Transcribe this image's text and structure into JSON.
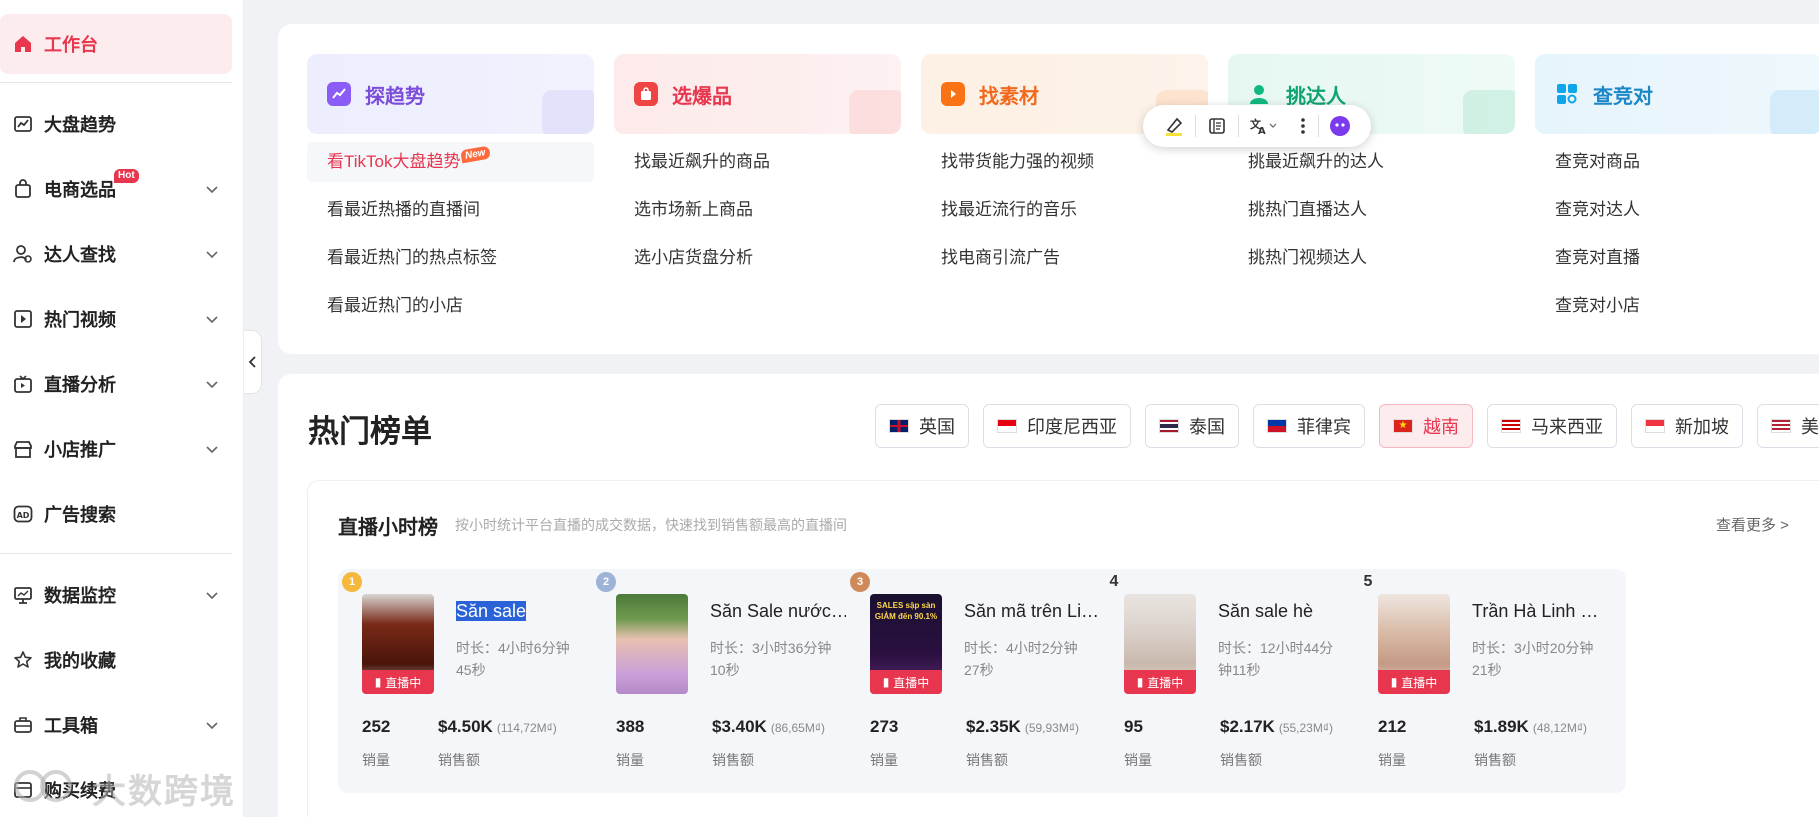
{
  "sidebar": {
    "items": [
      {
        "label": "工作台",
        "icon": "home-icon"
      },
      {
        "label": "大盘趋势",
        "icon": "trend-chart-icon"
      },
      {
        "label": "电商选品",
        "icon": "shopping-bag-icon",
        "badge": "Hot"
      },
      {
        "label": "达人查找",
        "icon": "user-search-icon"
      },
      {
        "label": "热门视频",
        "icon": "video-icon"
      },
      {
        "label": "直播分析",
        "icon": "tv-live-icon"
      },
      {
        "label": "小店推广",
        "icon": "shop-icon"
      },
      {
        "label": "广告搜索",
        "icon": "ad-icon"
      },
      {
        "label": "数据监控",
        "icon": "monitor-icon"
      },
      {
        "label": "我的收藏",
        "icon": "star-icon"
      },
      {
        "label": "工具箱",
        "icon": "toolbox-icon"
      },
      {
        "label": "购买续费",
        "icon": "cart-icon"
      }
    ],
    "watermark": "大数跨境"
  },
  "categories": [
    {
      "title": "探趋势",
      "links": [
        "看TikTok大盘趋势",
        "看最近热播的直播间",
        "看最近热门的热点标签",
        "看最近热门的小店"
      ],
      "new_badge": "New"
    },
    {
      "title": "选爆品",
      "links": [
        "找最近飙升的商品",
        "选市场新上商品",
        "选小店货盘分析"
      ]
    },
    {
      "title": "找素材",
      "links": [
        "找带货能力强的视频",
        "找最近流行的音乐",
        "找电商引流广告"
      ]
    },
    {
      "title": "挑达人",
      "links": [
        "挑最近飙升的达人",
        "挑热门直播达人",
        "挑热门视频达人"
      ]
    },
    {
      "title": "查竞对",
      "links": [
        "查竞对商品",
        "查竞对达人",
        "查竞对直播",
        "查竞对小店"
      ]
    }
  ],
  "hot_list": {
    "title": "热门榜单",
    "countries": [
      "英国",
      "印度尼西亚",
      "泰国",
      "菲律宾",
      "越南",
      "马来西亚",
      "新加坡",
      "美国"
    ],
    "active_country": "越南",
    "board": {
      "title": "直播小时榜",
      "subtitle": "按小时统计平台直播的成交数据，快速找到销售额最高的直播间",
      "more": "查看更多 >",
      "live_tag": "直播中",
      "duration_prefix": "时长：",
      "sales_label": "销量",
      "revenue_label": "销售额",
      "items": [
        {
          "rank": "1",
          "name": "Săn sale",
          "dur1": "4小时6分钟",
          "dur2": "45秒",
          "sales": "252",
          "revenue": "$4.50K",
          "local": "(114,72M₫)"
        },
        {
          "rank": "2",
          "name": "Săn Sale nước…",
          "dur1": "3小时36分钟",
          "dur2": "10秒",
          "sales": "388",
          "revenue": "$3.40K",
          "local": "(86,65M₫)"
        },
        {
          "rank": "3",
          "name": "Săn mã trên Li…",
          "dur1": "4小时2分钟",
          "dur2": "27秒",
          "sales": "273",
          "revenue": "$2.35K",
          "local": "(59,93M₫)",
          "thumb_text": "SALES sập sàn GIẢM đến 90.1%"
        },
        {
          "rank": "4",
          "name": "Săn sale hè",
          "dur1": "12小时44分",
          "dur2": "钟11秒",
          "sales": "95",
          "revenue": "$2.17K",
          "local": "(55,23M₫)"
        },
        {
          "rank": "5",
          "name": "Trần Hà Linh …",
          "dur1": "3小时20分钟",
          "dur2": "21秒",
          "sales": "212",
          "revenue": "$1.89K",
          "local": "(48,12M₫)"
        }
      ]
    }
  },
  "colors": {
    "accent": "#e8364e",
    "purple": "#8b5cf6",
    "orange": "#f97316",
    "green": "#10b981",
    "blue": "#0ea5e9"
  }
}
